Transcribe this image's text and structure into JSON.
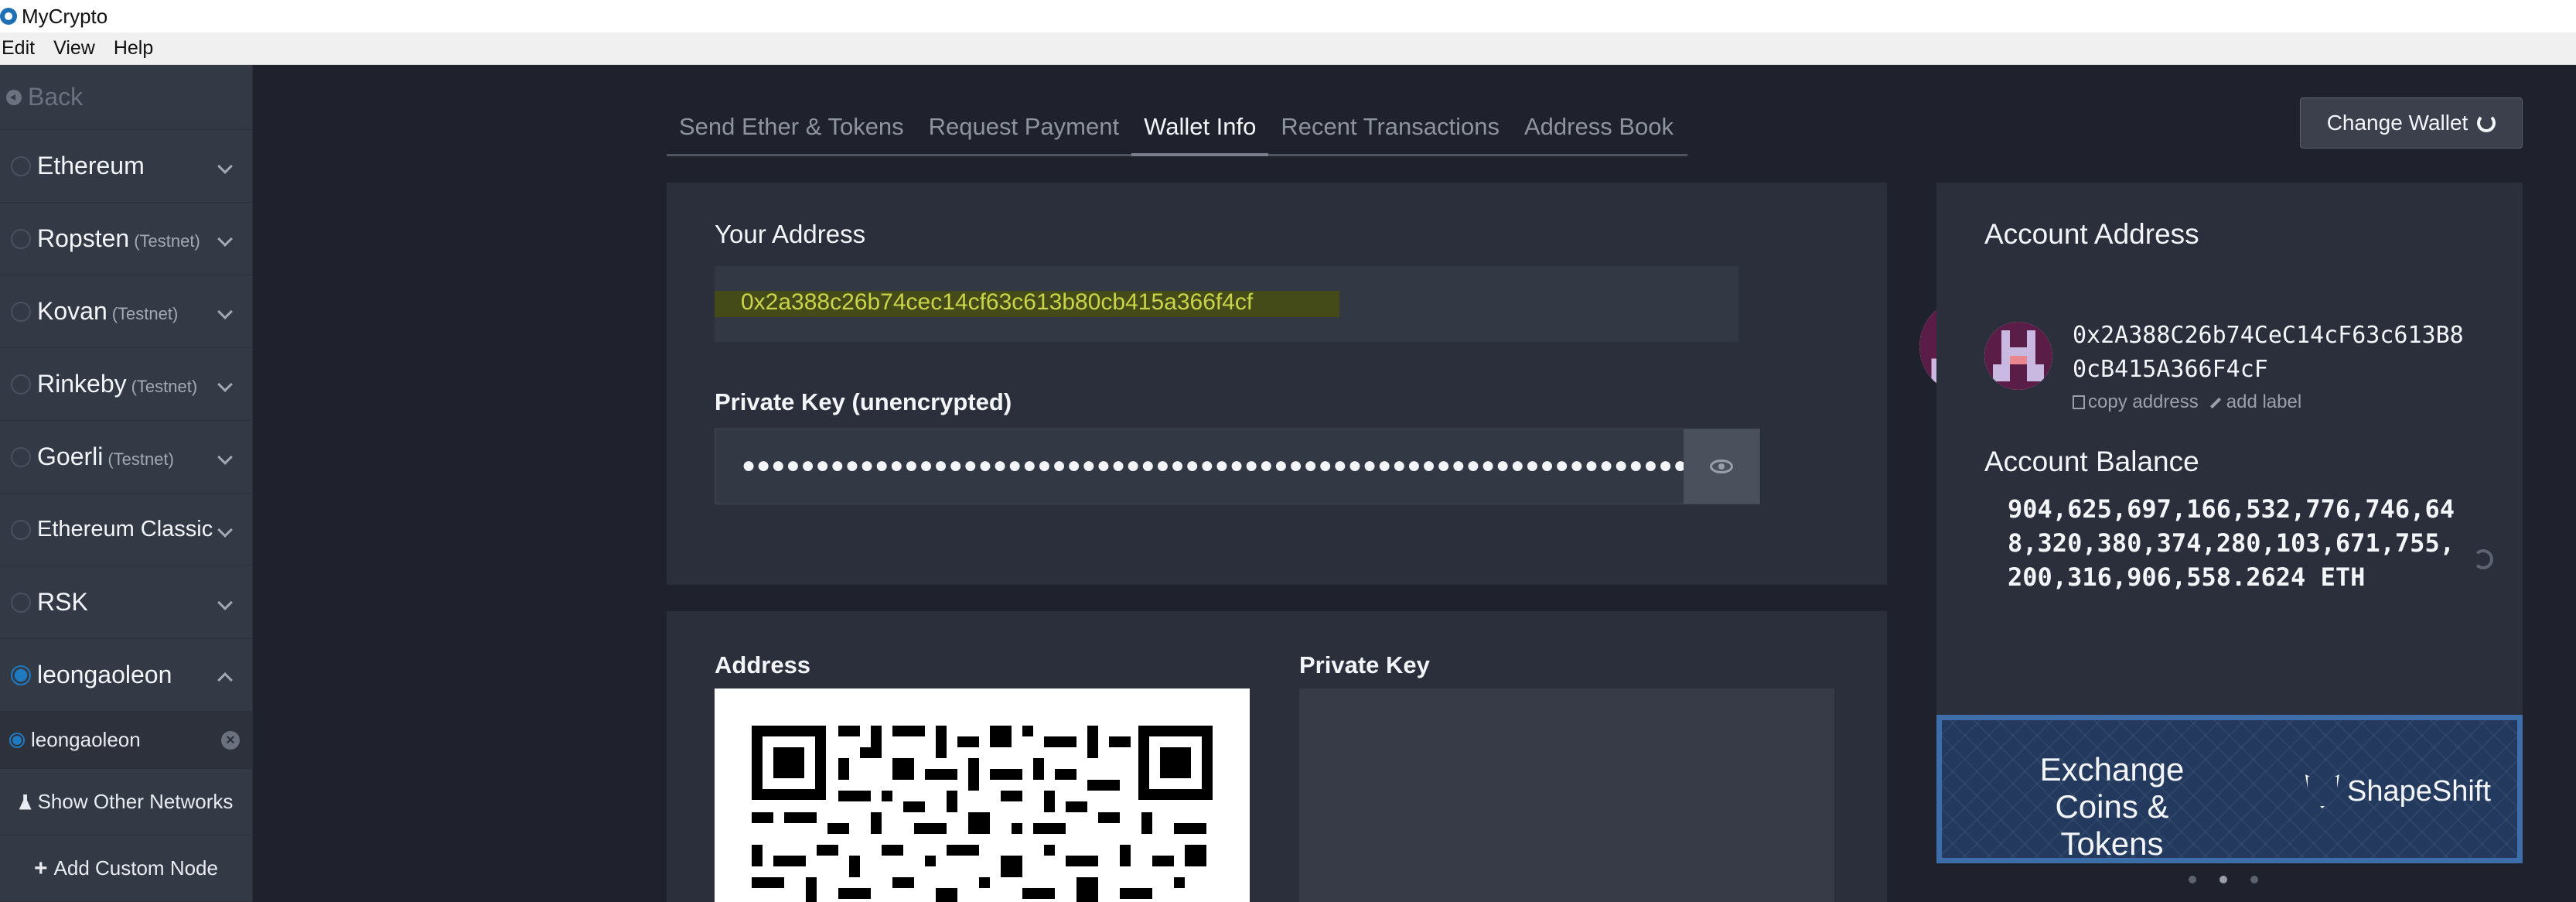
{
  "window": {
    "title": "MyCrypto"
  },
  "menu": [
    "Edit",
    "View",
    "Help"
  ],
  "sidebar": {
    "back_label": "Back",
    "networks": [
      {
        "name": "Ethereum",
        "tag": ""
      },
      {
        "name": "Ropsten",
        "tag": "(Testnet)"
      },
      {
        "name": "Kovan",
        "tag": "(Testnet)"
      },
      {
        "name": "Rinkeby",
        "tag": "(Testnet)"
      },
      {
        "name": "Goerli",
        "tag": "(Testnet)"
      },
      {
        "name": "Ethereum Classic",
        "tag": ""
      },
      {
        "name": "RSK",
        "tag": ""
      },
      {
        "name": "leongaoleon",
        "tag": ""
      }
    ],
    "selected_node": "leongaoleon",
    "show_other_networks": "Show Other Networks",
    "add_custom_node": "Add Custom Node"
  },
  "tabs": [
    "Send Ether & Tokens",
    "Request Payment",
    "Wallet Info",
    "Recent Transactions",
    "Address Book"
  ],
  "active_tab": "Wallet Info",
  "change_wallet_label": "Change Wallet",
  "wallet": {
    "your_address_label": "Your Address",
    "address": "0x2a388c26b74cec14cf63c613b80cb415a366f4cf",
    "private_key_label": "Private Key (unencrypted)",
    "private_key_mask": "●●●●●●●●●●●●●●●●●●●●●●●●●●●●●●●●●●●●●●●●●●●●●●●●●●●●●●●●●●●●●●●●",
    "qr_address_label": "Address",
    "qr_private_label": "Private Key"
  },
  "account": {
    "title": "Account Address",
    "address": "0x2A388C26b74CeC14cF63c613B80cB415A366F4cF",
    "copy_label": "copy address",
    "label_label": "add label",
    "balance_title": "Account Balance",
    "balance": "904,625,697,166,532,776,746,648,320,380,374,280,103,671,755,200,316,906,558.2624 ETH"
  },
  "promo": {
    "text": "Exchange Coins & Tokens",
    "brand": "ShapeShift"
  },
  "colors": {
    "sidebar_bg": "#343946",
    "main_bg": "#1f222d",
    "card_bg": "#2b2f3b",
    "address_highlight": "#c9d44a",
    "promo_bg": "#233a5e",
    "radio_active": "#1f7ac0"
  }
}
